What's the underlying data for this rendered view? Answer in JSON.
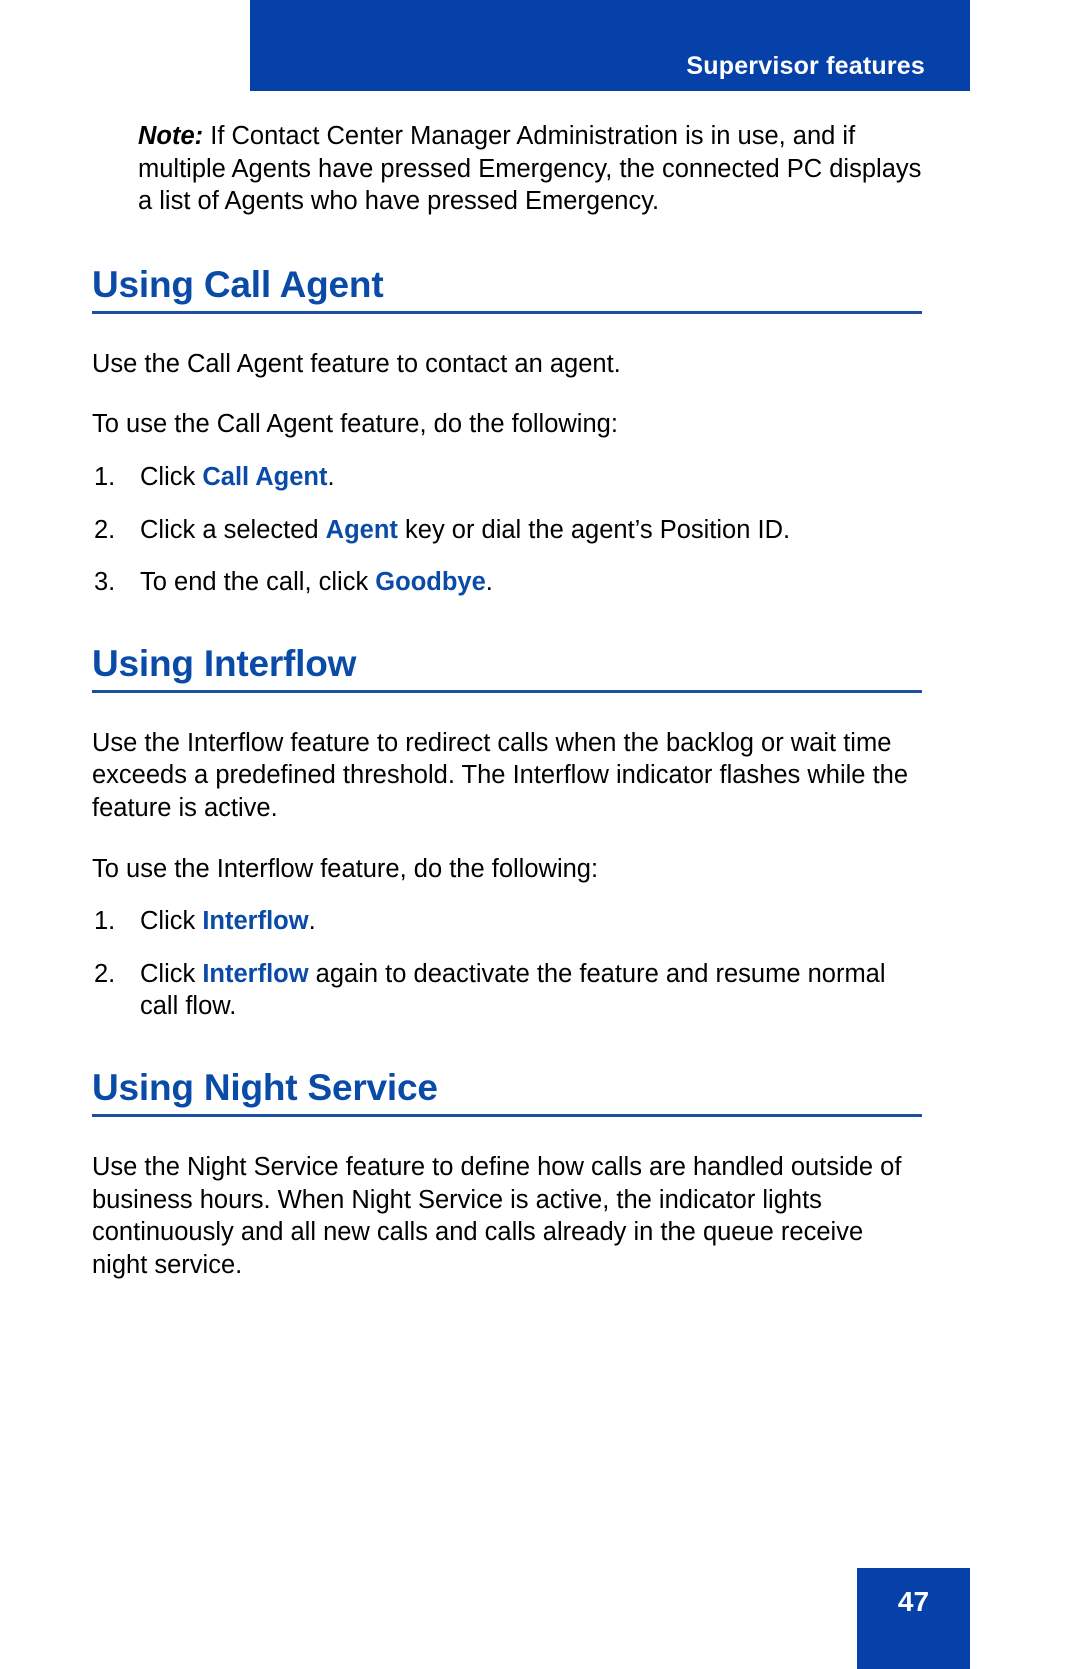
{
  "header": {
    "title": "Supervisor features"
  },
  "note": {
    "label": "Note:",
    "text": "If Contact Center Manager Administration is in use, and if multiple Agents have pressed Emergency, the connected PC displays a list of Agents who have pressed Emergency."
  },
  "sections": [
    {
      "heading": "Using Call Agent",
      "intro": "Use the Call Agent feature to contact an agent.",
      "lead_in": "To use the Call Agent feature, do the following:",
      "steps": [
        {
          "number": "1.",
          "before": "Click ",
          "keyword": "Call Agent",
          "after": "."
        },
        {
          "number": "2.",
          "before": "Click a selected ",
          "keyword": "Agent",
          "after": " key or dial the agent’s Position ID."
        },
        {
          "number": "3.",
          "before": "To end the call, click ",
          "keyword": "Goodbye",
          "after": "."
        }
      ]
    },
    {
      "heading": "Using Interflow",
      "intro": "Use the Interflow feature to redirect calls when the backlog or wait time exceeds a predefined threshold. The Interflow indicator flashes while the feature is active.",
      "lead_in": "To use the Interflow feature, do the following:",
      "steps": [
        {
          "number": "1.",
          "before": "Click ",
          "keyword": "Interflow",
          "after": "."
        },
        {
          "number": "2.",
          "before": "Click ",
          "keyword": "Interflow",
          "after": " again to deactivate the feature and resume normal call flow."
        }
      ]
    },
    {
      "heading": "Using Night Service",
      "intro": "Use the Night Service feature to define how calls are handled outside of business hours. When Night Service is active, the indicator lights continuously and all new calls and calls already in the queue receive night service.",
      "lead_in": "",
      "steps": []
    }
  ],
  "footer": {
    "page_number": "47"
  },
  "colors": {
    "brand_blue": "#0641AA",
    "heading_blue": "#0A4BA8",
    "rule_blue": "#1C4FA1",
    "body_text": "#000000"
  }
}
